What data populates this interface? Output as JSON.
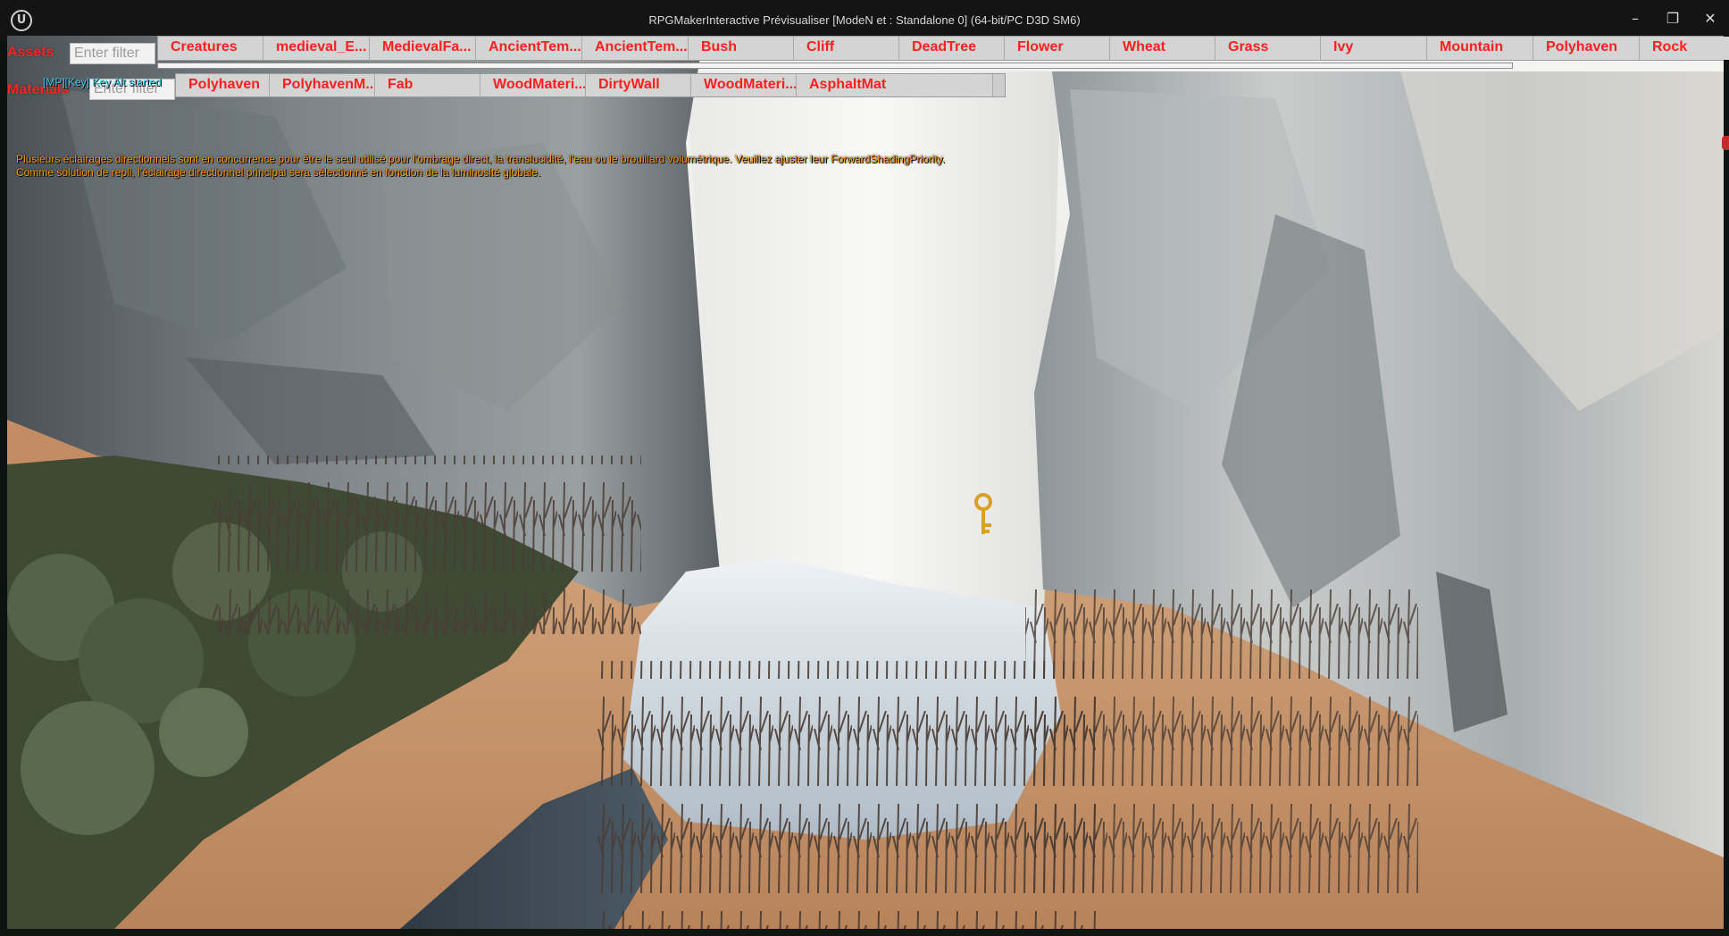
{
  "window": {
    "title": "RPGMakerInteractive Prévisualiser [ModeN et : Standalone 0]  (64-bit/PC D3D SM6)",
    "logo_glyph": "U",
    "controls": {
      "minimize": "–",
      "maximize": "❐",
      "close": "✕"
    }
  },
  "assets": {
    "label": "Assets",
    "filter_placeholder": "Enter filter",
    "buttons": [
      "Creatures",
      "medieval_E...",
      "MedievalFa...",
      "AncientTem...",
      "AncientTem...",
      "Bush",
      "Cliff",
      "DeadTree",
      "Flower",
      "Wheat",
      "Grass",
      "Ivy",
      "Mountain",
      "Polyhaven",
      "Rock"
    ]
  },
  "materials": {
    "label": "Materials",
    "filter_placeholder": "Enter filter",
    "buttons": [
      "Polyhaven",
      "PolyhavenM...",
      "Fab",
      "WoodMateri...",
      "DirtyWall",
      "WoodMateri...",
      "AsphaltMat"
    ]
  },
  "log_line": "[MP][Key] Key Alt started",
  "warning": {
    "line1": "Plusieurs éclairages directionnels sont en concurrence pour être le seul utilisé pour l'ombrage direct, la translucidité, l'eau ou le brouillard volumétrique. Veuillez ajuster leur ForwardShadingPriority.",
    "line2": "Comme solution de repli, l'éclairage directionnel principal sera sélectionné en fonction de la luminosité globale."
  },
  "icons": {
    "key": "key-icon",
    "logo": "unreal-logo-icon"
  },
  "colors": {
    "button_text": "#ff1f1f",
    "label_text": "#ff2424",
    "warning_text": "#ff9a10",
    "log_text": "#39c8e8",
    "titlebar": "#141414"
  }
}
